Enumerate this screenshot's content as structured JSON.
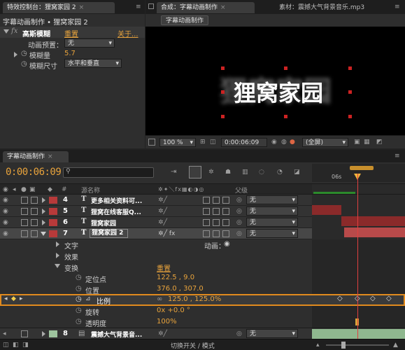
{
  "effects_panel": {
    "tab_label": "特效控制台：狸窝家园 2",
    "breadcrumb": "字幕动画制作 • 狸窝家园 2",
    "effect_fx": "fx",
    "effect_name": "高斯模糊",
    "reset_label": "重置",
    "about_label": "关于...",
    "preset_label": "动画预置：",
    "preset_value": "无",
    "blurriness_label": "模糊量",
    "blurriness_value": "5.7",
    "blur_dim_label": "模糊尺寸",
    "blur_dim_value": "水平和垂直"
  },
  "comp_panel": {
    "tab_label": "合成：字幕动画制作",
    "footage_tab_label": "素材：震撼大气背景音乐.mp3",
    "comp_button": "字幕动画制作",
    "preview_text": "狸窝家园",
    "zoom_value": "100 %",
    "time_value": "0:00:06:09",
    "view_value": "(全屏)"
  },
  "timeline": {
    "tab_label": "字幕动画制作",
    "current_time": "0:00:06:09",
    "search_placeholder": "",
    "col_source": "源名称",
    "col_parent": "父级",
    "ruler_label": "06s",
    "layers": [
      {
        "num": "4",
        "type": "T",
        "name": "更多相关资料可...",
        "parent": "无",
        "color": "#b73a3a"
      },
      {
        "num": "5",
        "type": "T",
        "name": "狸窝在线客服Q...",
        "parent": "无",
        "color": "#b73a3a"
      },
      {
        "num": "6",
        "type": "T",
        "name": "狸窝家园",
        "parent": "无",
        "color": "#b73a3a"
      },
      {
        "num": "7",
        "type": "T",
        "name": "狸窝家园 2",
        "parent": "无",
        "color": "#b73a3a"
      },
      {
        "num": "8",
        "type": "",
        "name": "震撼大气背景音...",
        "parent": "无",
        "color": "#9ec49e"
      }
    ],
    "text_group": "文字",
    "animate_label": "动画：",
    "effects_group": "效果",
    "transform_group": "变换",
    "transform_reset": "重置",
    "props": [
      {
        "name": "定位点",
        "value": "122.5 , 9.0"
      },
      {
        "name": "位置",
        "value": "376.0 , 307.0"
      },
      {
        "name": "比例",
        "value": "125.0 , 125.0%"
      },
      {
        "name": "旋转",
        "value": "0x +0.0 °"
      },
      {
        "name": "透明度",
        "value": "100%"
      }
    ],
    "footer_label": "切换开关 / 模式"
  }
}
